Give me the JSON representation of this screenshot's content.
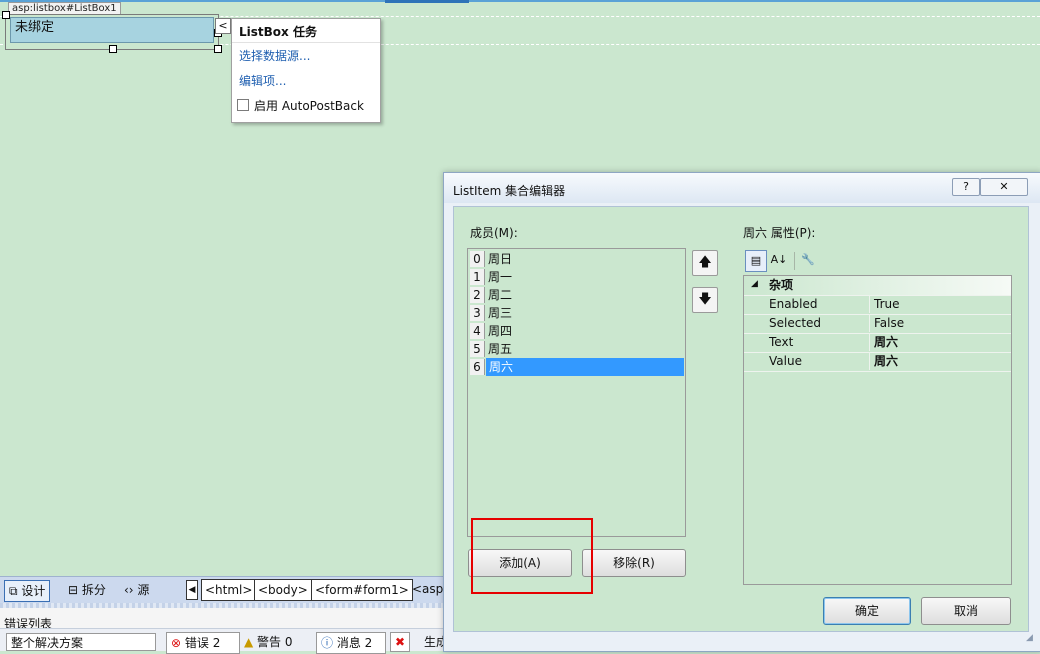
{
  "designer": {
    "control_tag": "asp:listbox#ListBox1",
    "listbox_text": "未绑定",
    "smart_tag_glyph": "<"
  },
  "tasks_popup": {
    "title": "ListBox 任务",
    "choose_datasource": "选择数据源...",
    "edit_items": "编辑项...",
    "autopostback_label": "启用 AutoPostBack",
    "autopostback_checked": false
  },
  "view_bar": {
    "design_label": "设计",
    "split_label": "拆分",
    "source_label": "源",
    "breadcrumbs": [
      "<html>",
      "<body>",
      "<form#form1>",
      "<asp:"
    ]
  },
  "error_panel": {
    "title": "错误列表",
    "scope_select": "整个解决方案",
    "errors_label": "错误 2",
    "warnings_label": "警告 0",
    "messages_label": "消息 2",
    "build_label": "生成"
  },
  "dialog": {
    "title": "ListItem 集合编辑器",
    "help_label": "?",
    "close_label": "✕",
    "members_label": "成员(M):",
    "members": [
      {
        "index": "0",
        "text": "周日"
      },
      {
        "index": "1",
        "text": "周一"
      },
      {
        "index": "2",
        "text": "周二"
      },
      {
        "index": "3",
        "text": "周三"
      },
      {
        "index": "4",
        "text": "周四"
      },
      {
        "index": "5",
        "text": "周五"
      },
      {
        "index": "6",
        "text": "周六"
      }
    ],
    "selected_index": 6,
    "add_label": "添加(A)",
    "remove_label": "移除(R)",
    "properties_label": "周六 属性(P):",
    "category": "杂项",
    "properties": [
      {
        "name": "Enabled",
        "value": "True",
        "bold": false
      },
      {
        "name": "Selected",
        "value": "False",
        "bold": false
      },
      {
        "name": "Text",
        "value": "周六",
        "bold": true
      },
      {
        "name": "Value",
        "value": "周六",
        "bold": true
      }
    ],
    "ok_label": "确定",
    "cancel_label": "取消"
  }
}
